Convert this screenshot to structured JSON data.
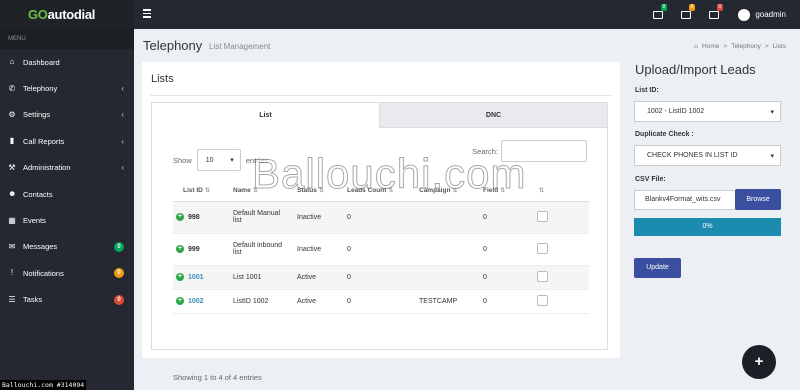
{
  "topbar": {
    "logo_go": "GO",
    "logo_rest": "autodial",
    "icons": [
      {
        "name": "envelope-icon",
        "badge": "8",
        "badge_color": "#00a65a"
      },
      {
        "name": "folder-icon",
        "badge": "6",
        "badge_color": "#f39c12"
      },
      {
        "name": "tasks-icon",
        "badge": "0",
        "badge_color": "#dd4b39"
      }
    ],
    "user_name": "goadmin"
  },
  "sidebar": {
    "header": "MENU",
    "items": [
      {
        "label": "Dashboard",
        "icon": "⌂",
        "chevron": "",
        "count": ""
      },
      {
        "label": "Telephony",
        "icon": "✆",
        "chevron": "‹",
        "count": ""
      },
      {
        "label": "Settings",
        "icon": "⚙",
        "chevron": "‹",
        "count": ""
      },
      {
        "label": "Call Reports",
        "icon": "▮",
        "chevron": "‹",
        "count": ""
      },
      {
        "label": "Administration",
        "icon": "⚒",
        "chevron": "‹",
        "count": ""
      },
      {
        "label": "Contacts",
        "icon": "☻",
        "chevron": "",
        "count": ""
      },
      {
        "label": "Events",
        "icon": "▦",
        "chevron": "",
        "count": ""
      },
      {
        "label": "Messages",
        "icon": "✉",
        "chevron": "",
        "count": "0",
        "count_color": "#00a65a"
      },
      {
        "label": "Notifications",
        "icon": "!",
        "chevron": "",
        "count": "0",
        "count_color": "#f39c12"
      },
      {
        "label": "Tasks",
        "icon": "☰",
        "chevron": "",
        "count": "0",
        "count_color": "#dd4b39"
      }
    ]
  },
  "header": {
    "title": "Telephony",
    "subtitle": "List Management",
    "breadcrumb": [
      "Home",
      ">",
      "Telephony",
      ">",
      "Lists"
    ]
  },
  "lists_box": {
    "title": "Lists",
    "tabs": [
      "List",
      "DNC"
    ],
    "show_label": "Show",
    "entries_value": "10",
    "entries_label": "entries",
    "search_label": "Search:",
    "columns": [
      "List ID",
      "Name",
      "Status",
      "Leads Count",
      "Campaign",
      "Field"
    ],
    "rows": [
      {
        "id": "998",
        "name": "Default Manual list",
        "status": "Inactive",
        "leads": "0",
        "campaign": "",
        "field": "0",
        "link": false
      },
      {
        "id": "999",
        "name": "Default inbound list",
        "status": "Inactive",
        "leads": "0",
        "campaign": "",
        "field": "0",
        "link": false
      },
      {
        "id": "1001",
        "name": "List 1001",
        "status": "Active",
        "leads": "0",
        "campaign": "",
        "field": "0",
        "link": true
      },
      {
        "id": "1002",
        "name": "ListID 1002",
        "status": "Active",
        "leads": "0",
        "campaign": "TESTCAMP",
        "field": "0",
        "link": true
      }
    ],
    "showing": "Showing 1 to 4 of 4 entries"
  },
  "upload": {
    "title": "Upload/Import Leads",
    "list_id_label": "List ID:",
    "list_id_value": "1002 - ListID 1002",
    "dup_label": "Duplicate Check :",
    "dup_value": "CHECK PHONES IN LIST ID",
    "csv_label": "CSV File:",
    "csv_value": "Blankv4Format_wits.csv",
    "browse_label": "Browse",
    "progress_fraction": 1.0,
    "progress_text": "0%",
    "update_label": "Update"
  },
  "fab_label": "+",
  "watermark": "Ballouchi.com",
  "watermark_tag": "Ballouchi.com #314094"
}
